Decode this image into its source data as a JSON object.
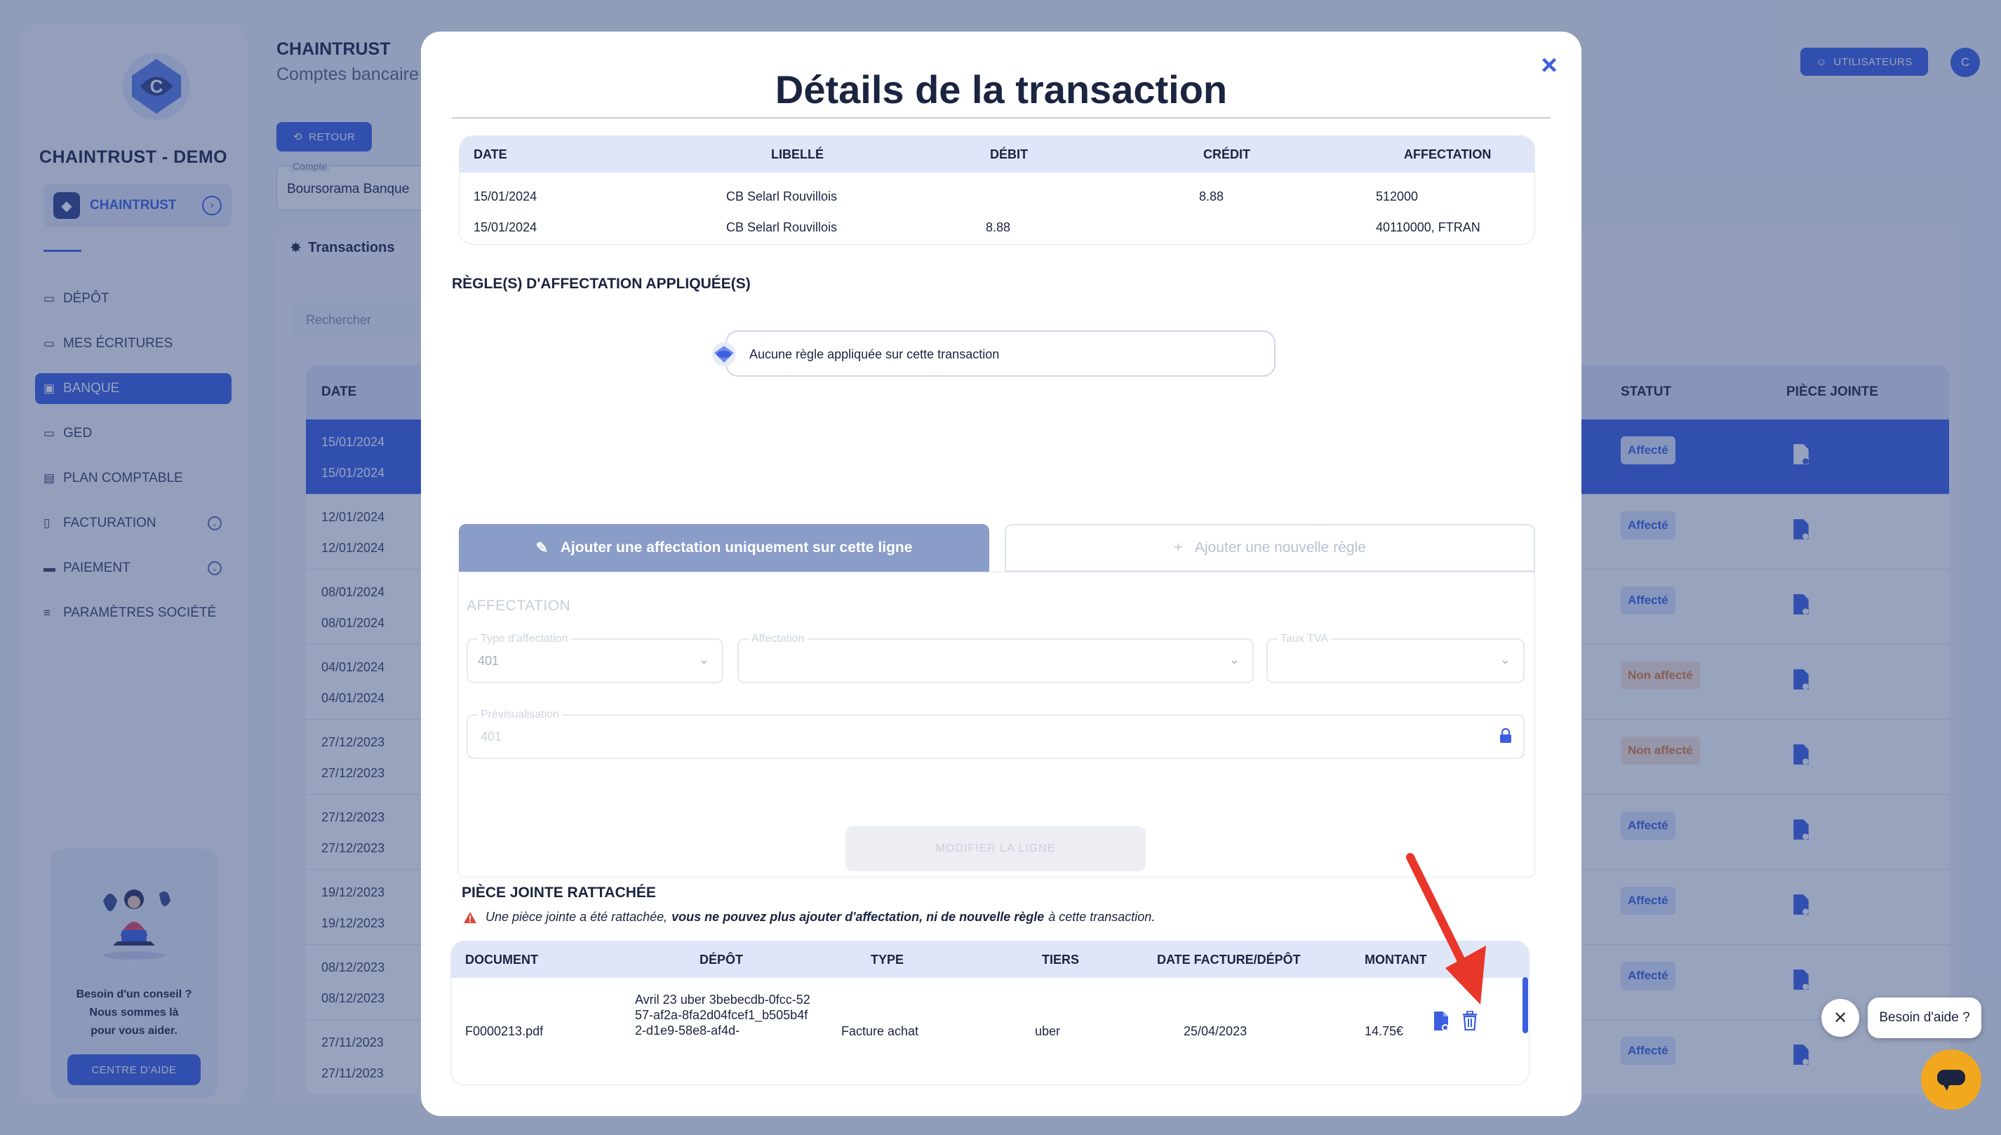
{
  "app": {
    "brand": "CHAINTRUST - DEMO",
    "company": "CHAINTRUST",
    "title": "CHAINTRUST",
    "subtitle": "Comptes bancaire",
    "retour": "RETOUR",
    "compte_label": "Compte",
    "compte_value": "Boursorama Banque",
    "users_button": "UTILISATEURS",
    "avatar_initial": "C",
    "accent": "#3b5fe0"
  },
  "sidebar": {
    "items": [
      {
        "label": "DÉPÔT",
        "icon": "folder-icon"
      },
      {
        "label": "MES ÉCRITURES",
        "icon": "folder-icon"
      },
      {
        "label": "BANQUE",
        "icon": "bank-icon"
      },
      {
        "label": "GED",
        "icon": "folder-icon"
      },
      {
        "label": "PLAN COMPTABLE",
        "icon": "book-icon"
      },
      {
        "label": "FACTURATION",
        "icon": "invoice-icon"
      },
      {
        "label": "PAIEMENT",
        "icon": "card-icon"
      },
      {
        "label": "PARAMÈTRES SOCIÉTÉ",
        "icon": "sliders-icon"
      }
    ],
    "help": {
      "line1": "Besoin d'un conseil ?",
      "line2": "Nous sommes là",
      "line3": "pour vous aider.",
      "button": "CENTRE D'AIDE"
    }
  },
  "main": {
    "tab": "Transactions",
    "search_placeholder": "Rechercher",
    "headers": {
      "date": "DATE",
      "statut": "STATUT",
      "piece": "PIÈCE JOINTE"
    },
    "rows": [
      {
        "d1": "15/01/2024",
        "d2": "15/01/2024",
        "status": "Affecté"
      },
      {
        "d1": "12/01/2024",
        "d2": "12/01/2024",
        "status": "Affecté"
      },
      {
        "d1": "08/01/2024",
        "d2": "08/01/2024",
        "status": "Affecté"
      },
      {
        "d1": "04/01/2024",
        "d2": "04/01/2024",
        "status": "Non affecté"
      },
      {
        "d1": "27/12/2023",
        "d2": "27/12/2023",
        "status": "Non affecté"
      },
      {
        "d1": "27/12/2023",
        "d2": "27/12/2023",
        "status": "Affecté"
      },
      {
        "d1": "19/12/2023",
        "d2": "19/12/2023",
        "status": "Affecté"
      },
      {
        "d1": "08/12/2023",
        "d2": "08/12/2023",
        "status": "Affecté"
      },
      {
        "d1": "27/11/2023",
        "d2": "27/11/2023",
        "status": "Affecté"
      }
    ]
  },
  "modal": {
    "title": "Détails de la transaction",
    "close": "×",
    "table": {
      "headers": [
        "DATE",
        "LIBELLÉ",
        "DÉBIT",
        "CRÉDIT",
        "AFFECTATION"
      ],
      "rows": [
        {
          "date": "15/01/2024",
          "libelle": "CB Selarl Rouvillois",
          "debit": "",
          "credit": "8.88",
          "affectation": "512000"
        },
        {
          "date": "15/01/2024",
          "libelle": "CB Selarl Rouvillois",
          "debit": "8.88",
          "credit": "",
          "affectation": "40110000, FTRAN"
        }
      ]
    },
    "rules_heading": "RÈGLE(S) D'AFFECTATION APPLIQUÉE(S)",
    "no_rule": "Aucune règle appliquée sur cette transaction",
    "tab_left": "Ajouter une affectation uniquement sur cette ligne",
    "tab_right": "Ajouter une nouvelle règle",
    "affectation": {
      "title": "AFFECTATION",
      "type_label": "Type d'affectation",
      "type_value": "401",
      "aff_label": "Affectation",
      "aff_value": "",
      "tva_label": "Taux TVA",
      "tva_value": "",
      "preview_label": "Prévisualisation",
      "preview_value": "401",
      "button": "MODIFIER LA LIGNE"
    },
    "attachment": {
      "heading": "PIÈCE JOINTE RATTACHÉE",
      "warn_pre": "Une pièce jointe a été rattachée,",
      "warn_bold": "vous ne pouvez plus ajouter d'affectation, ni de nouvelle règle",
      "warn_post": "à cette transaction.",
      "headers": [
        "DOCUMENT",
        "DÉPÔT",
        "TYPE",
        "TIERS",
        "DATE FACTURE/DÉPÔT",
        "MONTANT"
      ],
      "row": {
        "document": "F0000213.pdf",
        "depot": "Avril 23 uber 3bebecdb-0fcc-5257-af2a-8fa2d04fcef1_b505b4f2-d1e9-58e8-af4d-",
        "type": "Facture achat",
        "tiers": "uber",
        "date": "25/04/2023",
        "montant": "14.75€"
      }
    }
  },
  "chat": {
    "bubble": "Besoin d'aide ?"
  }
}
